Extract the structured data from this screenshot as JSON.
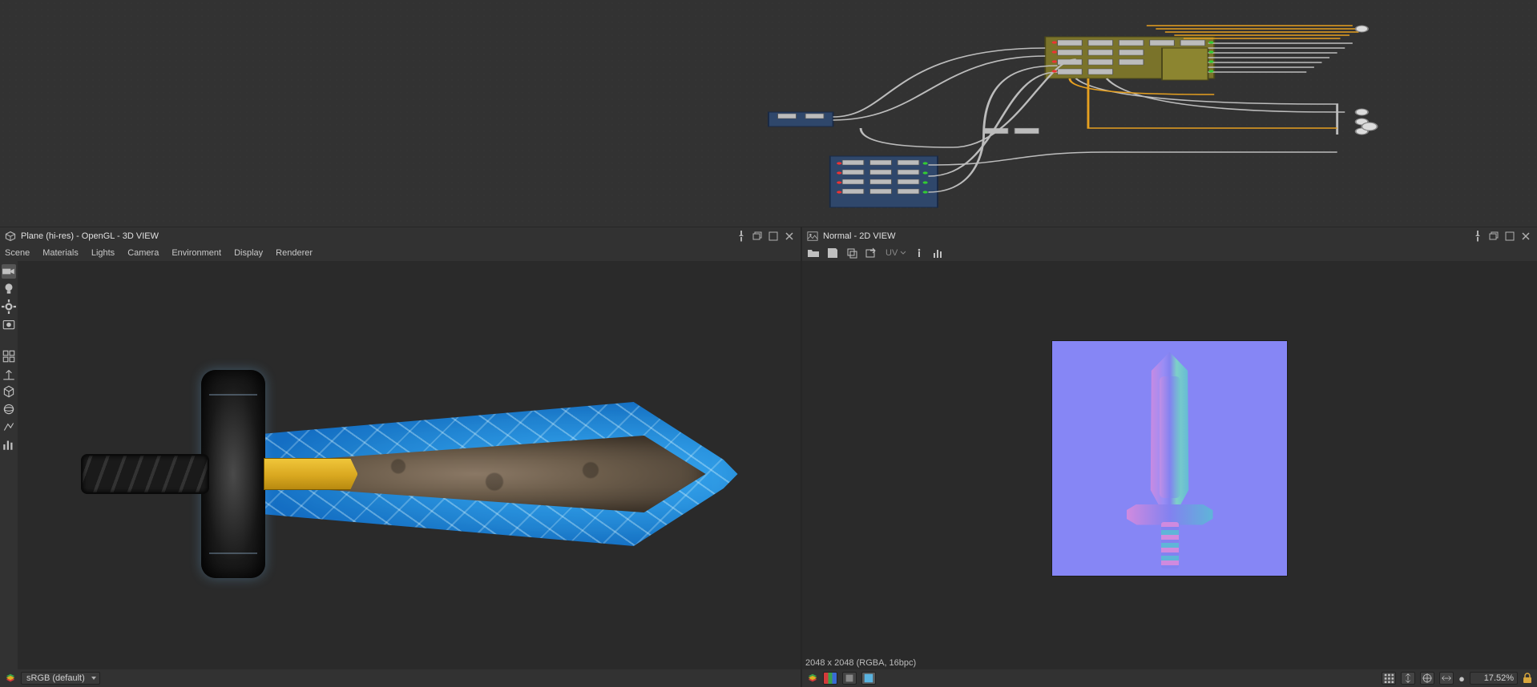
{
  "panel3d": {
    "title": "Plane (hi-res) - OpenGL - 3D VIEW",
    "menu": [
      "Scene",
      "Materials",
      "Lights",
      "Camera",
      "Environment",
      "Display",
      "Renderer"
    ],
    "colorspace": "sRGB (default)"
  },
  "panel2d": {
    "title": "Normal - 2D VIEW",
    "uv_label": "UV",
    "image_info": "2048 x 2048 (RGBA, 16bpc)",
    "zoom": "17.52%"
  }
}
